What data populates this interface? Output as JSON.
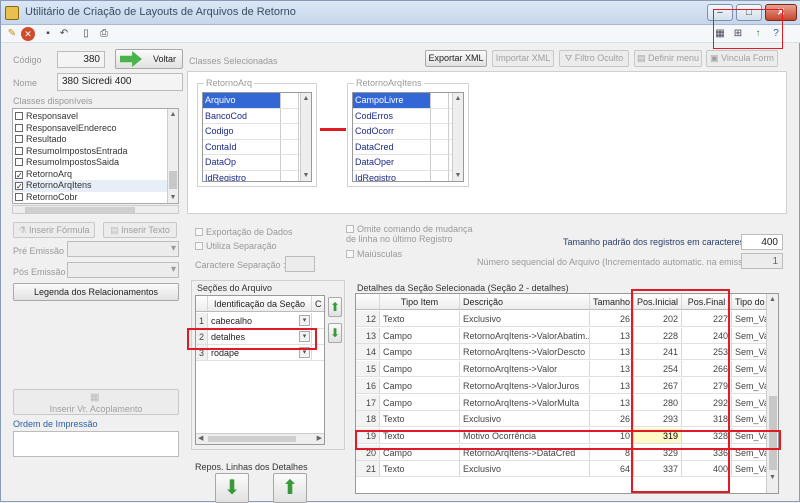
{
  "window": {
    "title": "Utilitário de Criação de Layouts de Arquivos de Retorno"
  },
  "toolbar": {
    "items": [
      "new-icon",
      "cancel-icon",
      "save-icon",
      "undo-icon",
      "doc-icon",
      "print-icon"
    ],
    "right_items": [
      "grid-icon",
      "tree-icon",
      "up-icon",
      "help-icon"
    ]
  },
  "left": {
    "codigo_label": "Código",
    "codigo_value": "380",
    "voltar_label": "Voltar",
    "nome_label": "Nome",
    "nome_value": "380 Sicredi 400",
    "classes_disponiveis_label": "Classes disponíveis",
    "classes": [
      {
        "label": "Responsavel",
        "checked": false
      },
      {
        "label": "ResponsavelEndereco",
        "checked": false
      },
      {
        "label": "Resultado",
        "checked": false
      },
      {
        "label": "ResumoImpostosEntrada",
        "checked": false
      },
      {
        "label": "ResumoImpostosSaida",
        "checked": false
      },
      {
        "label": "RetornoArq",
        "checked": true
      },
      {
        "label": "RetornoArqItens",
        "checked": true
      },
      {
        "label": "RetornoCobr",
        "checked": false
      }
    ],
    "inserir_formula": "Inserir Fórmula",
    "inserir_texto": "Inserir Texto",
    "pre_emissao_label": "Pré Emissão",
    "pos_emissao_label": "Pós Emissão",
    "legenda_button": "Legenda dos Relacionamentos",
    "inserir_acoplamento": "Inserir Vr. Acoplamento",
    "ordem_impressao_label": "Ordem de Impressão"
  },
  "center": {
    "classes_selecionadas_label": "Classes Selecionadas",
    "exportar_xml": "Exportar XML",
    "importar_xml": "Importar XML",
    "filtro_oculto": "Filtro Oculto",
    "definir_menu": "Definir menu",
    "vincula_form": "Vincula Form",
    "retorno_arq_title": "RetornoArq",
    "retorno_arq_fields": [
      "Arquivo",
      "BancoCod",
      "Codigo",
      "ContaId",
      "DataOp",
      "IdRegistro"
    ],
    "retorno_arqitens_title": "RetornoArqItens",
    "retorno_arqitens_fields": [
      "CampoLivre",
      "CodErros",
      "CodOcorr",
      "DataCred",
      "DataOper",
      "IdRegistro"
    ],
    "exportacao_dados": "Exportação de Dados",
    "utiliza_separacao": "Utiliza Separação",
    "caractere_separacao": "Caractere Separação :",
    "omite_comando": "Omite comando de mudança de linha no último Registro",
    "maiusculas": "Maiúsculas",
    "tamanho_label": "Tamanho padrão dos registros em caracteres:",
    "tamanho_value": "400",
    "numero_seq_label": "Número sequencial do Arquivo (Incrementado automatic. na emissão):",
    "numero_seq_value": "1"
  },
  "secoes": {
    "title": "Seções do Arquivo",
    "header": "Identificação da Seção",
    "header_c": "C",
    "rows": [
      {
        "n": "1",
        "name": "cabecalho"
      },
      {
        "n": "2",
        "name": "detalhes"
      },
      {
        "n": "3",
        "name": "rodape"
      }
    ],
    "repos_label": "Repos. Linhas dos Detalhes"
  },
  "detalhes": {
    "title": "Detalhes da Seção Selecionada (Seção 2 - detalhes)",
    "headers": [
      "",
      "Tipo Item",
      "Descrição",
      "Tamanho",
      "Pos.Inicial",
      "Pos.Final",
      "Tipo do"
    ],
    "rows": [
      {
        "n": "12",
        "tipo": "Texto",
        "desc": "Exclusivo",
        "tam": "26",
        "ini": "202",
        "fim": "227",
        "tp": "Sem_Val"
      },
      {
        "n": "13",
        "tipo": "Campo",
        "desc": "RetornoArqItens->ValorAbatim...",
        "tam": "13",
        "ini": "228",
        "fim": "240",
        "tp": "Sem_Val"
      },
      {
        "n": "14",
        "tipo": "Campo",
        "desc": "RetornoArqItens->ValorDescto",
        "tam": "13",
        "ini": "241",
        "fim": "253",
        "tp": "Sem_Val"
      },
      {
        "n": "15",
        "tipo": "Campo",
        "desc": "RetornoArqItens->Valor",
        "tam": "13",
        "ini": "254",
        "fim": "266",
        "tp": "Sem_Val"
      },
      {
        "n": "16",
        "tipo": "Campo",
        "desc": "RetornoArqItens->ValorJuros",
        "tam": "13",
        "ini": "267",
        "fim": "279",
        "tp": "Sem_Val"
      },
      {
        "n": "17",
        "tipo": "Campo",
        "desc": "RetornoArqItens->ValorMulta",
        "tam": "13",
        "ini": "280",
        "fim": "292",
        "tp": "Sem_Val"
      },
      {
        "n": "18",
        "tipo": "Texto",
        "desc": "Exclusivo",
        "tam": "26",
        "ini": "293",
        "fim": "318",
        "tp": "Sem_Val"
      },
      {
        "n": "19",
        "tipo": "Texto",
        "desc": "Motivo Ocorrência",
        "tam": "10",
        "ini": "319",
        "fim": "328",
        "tp": "Sem_Val"
      },
      {
        "n": "20",
        "tipo": "Campo",
        "desc": "RetornoArqItens->DataCred",
        "tam": "8",
        "ini": "329",
        "fim": "336",
        "tp": "Sem_Val"
      },
      {
        "n": "21",
        "tipo": "Texto",
        "desc": "Exclusivo",
        "tam": "64",
        "ini": "337",
        "fim": "400",
        "tp": "Sem_Val"
      }
    ]
  }
}
